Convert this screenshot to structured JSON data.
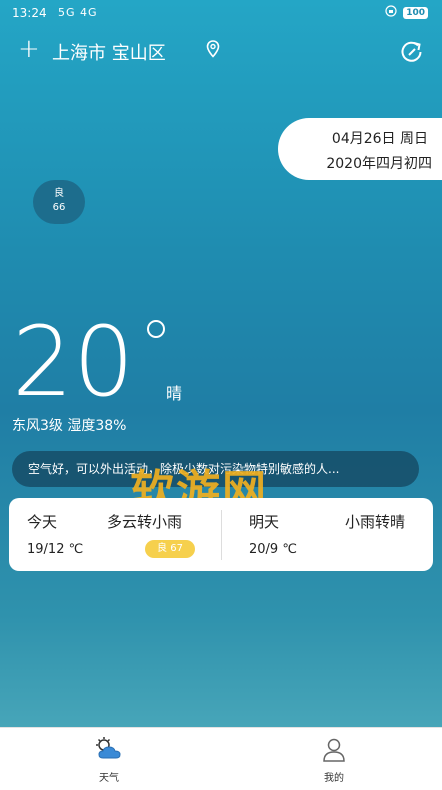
{
  "status_bar": {
    "time": "13:24",
    "signal": "5G 4G",
    "battery": "100"
  },
  "header": {
    "city": "上海市 宝山区"
  },
  "date": {
    "solar": "04月26日   周日",
    "lunar": "2020年四月初四"
  },
  "aqi": {
    "level": "良",
    "value": "66"
  },
  "current": {
    "temperature": "20",
    "condition": "晴",
    "wind_humidity": "东风3级  湿度38%"
  },
  "advice": "空气好，可以外出活动，除极少数对污染物特别敏感的人...",
  "watermark": "软游网",
  "forecast": {
    "today": {
      "label": "今天",
      "condition": "多云转小雨",
      "temp": "19/12 ℃",
      "aqi": "良  67"
    },
    "tomorrow": {
      "label": "明天",
      "condition": "小雨转晴",
      "temp": "20/9 ℃"
    }
  },
  "tabs": [
    {
      "label": "天气",
      "icon": "weather-icon"
    },
    {
      "label": "我的",
      "icon": "profile-icon"
    }
  ],
  "colors": {
    "accent": "#1f8cb0",
    "aqi_pill": "#f6d04d",
    "watermark": "#f0b020"
  }
}
